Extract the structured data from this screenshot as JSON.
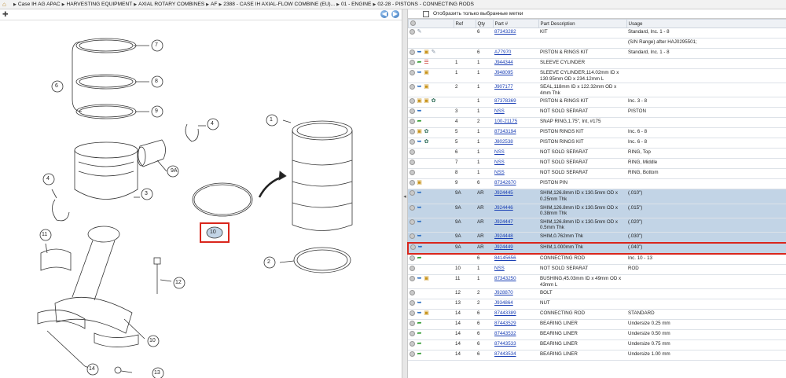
{
  "breadcrumb": [
    "Case IH AG APAC",
    "HARVESTING EQUIPMENT",
    "AXIAL ROTARY COMBINES",
    "AF",
    "2388 - CASE IH AXIAL-FLOW COMBINE (EU)...",
    "01 - ENGINE",
    "02-28 - PISTONS - CONNECTING RODS"
  ],
  "filter_label": "Отобразить только выбранные метки",
  "columns": [
    "",
    "Ref",
    "Qty",
    "Part #",
    "Part Description",
    "Usage"
  ],
  "diagram_callouts": [
    "1",
    "2",
    "3",
    "4",
    "4",
    "5",
    "6",
    "7",
    "8",
    "9",
    "9A",
    "10",
    "11",
    "12",
    "13",
    "14"
  ],
  "rows": [
    {
      "icons": [
        "open",
        "wrench"
      ],
      "ref": "",
      "qty": "6",
      "part": "87343282",
      "desc": "KIT",
      "usage": "Standard, Inc. 1 - 8"
    },
    {
      "icons": [],
      "ref": "",
      "qty": "",
      "part": "",
      "desc": "",
      "usage": "(S/N Range) after HAJ0295501;"
    },
    {
      "icons": [
        "open",
        "blue",
        "box",
        "wrench"
      ],
      "ref": "",
      "qty": "6",
      "part": "A77970",
      "desc": "PISTON & RINGS KIT",
      "usage": "Standard, Inc. 1 - 8"
    },
    {
      "icons": [
        "open",
        "green",
        "red"
      ],
      "ref": "1",
      "qty": "1",
      "part": "J944344",
      "desc": "SLEEVE CYLINDER",
      "usage": ""
    },
    {
      "icons": [
        "open",
        "blue",
        "box"
      ],
      "ref": "1",
      "qty": "1",
      "part": "J948095",
      "desc": "SLEEVE CYLINDER,114.02mm ID x 130.95mm OD x 234.12mm L",
      "usage": ""
    },
    {
      "icons": [
        "open",
        "blue",
        "box"
      ],
      "ref": "2",
      "qty": "1",
      "part": "J907177",
      "desc": "SEAL,118mm ID x 122.32mm OD x 4mm Thk",
      "usage": ""
    },
    {
      "icons": [
        "open",
        "box",
        "box",
        "gear"
      ],
      "ref": "",
      "qty": "1",
      "part": "87378369",
      "desc": "PISTON & RINGS KIT",
      "usage": "Inc. 3 - 8"
    },
    {
      "icons": [
        "open",
        "blue"
      ],
      "ref": "3",
      "qty": "1",
      "part": "NSS",
      "desc": "NOT SOLD SEPARAT",
      "usage": "PISTON"
    },
    {
      "icons": [
        "open",
        "green"
      ],
      "ref": "4",
      "qty": "2",
      "part": "100-21175",
      "desc": "SNAP RING,1.75\", Int, #175",
      "usage": ""
    },
    {
      "icons": [
        "open",
        "box",
        "gear"
      ],
      "ref": "5",
      "qty": "1",
      "part": "87343194",
      "desc": "PISTON RINGS KIT",
      "usage": "Inc. 6 - 8"
    },
    {
      "icons": [
        "open",
        "blue",
        "gear"
      ],
      "ref": "5",
      "qty": "1",
      "part": "J802538",
      "desc": "PISTON RINGS KIT",
      "usage": "Inc. 6 - 8"
    },
    {
      "icons": [
        "open"
      ],
      "ref": "6",
      "qty": "1",
      "part": "NSS",
      "desc": "NOT SOLD SEPARAT",
      "usage": "RING, Top"
    },
    {
      "icons": [
        "open"
      ],
      "ref": "7",
      "qty": "1",
      "part": "NSS",
      "desc": "NOT SOLD SEPARAT",
      "usage": "RING, Middle"
    },
    {
      "icons": [
        "open"
      ],
      "ref": "8",
      "qty": "1",
      "part": "NSS",
      "desc": "NOT SOLD SEPARAT",
      "usage": "RING, Bottom"
    },
    {
      "icons": [
        "open",
        "box"
      ],
      "ref": "9",
      "qty": "6",
      "part": "87342670",
      "desc": "PISTON PIN",
      "usage": ""
    },
    {
      "icons": [
        "open",
        "blue"
      ],
      "ref": "9A",
      "qty": "AR",
      "part": "J924445",
      "desc": "SHIM,126.8mm ID x 130.5mm OD x 0.25mm Thk",
      "usage": "(.010\")",
      "sel": true
    },
    {
      "icons": [
        "open",
        "blue"
      ],
      "ref": "9A",
      "qty": "AR",
      "part": "J924446",
      "desc": "SHIM,126.8mm ID x 130.5mm OD x 0.38mm Thk",
      "usage": "(.015\")",
      "sel": true
    },
    {
      "icons": [
        "open",
        "blue"
      ],
      "ref": "9A",
      "qty": "AR",
      "part": "J924447",
      "desc": "SHIM,126.8mm ID x 130.5mm OD x 0.5mm Thk",
      "usage": "(.020\")",
      "sel": true
    },
    {
      "icons": [
        "open",
        "blue"
      ],
      "ref": "9A",
      "qty": "AR",
      "part": "J924448",
      "desc": "SHIM,0.762mm Thk",
      "usage": "(.030\")",
      "sel": true
    },
    {
      "icons": [
        "open",
        "blue"
      ],
      "ref": "9A",
      "qty": "AR",
      "part": "J924449",
      "desc": "SHIM,1.000mm Thk",
      "usage": "(.040\")",
      "sel": true,
      "hl": true
    },
    {
      "icons": [
        "open",
        "green"
      ],
      "ref": "",
      "qty": "6",
      "part": "84145656",
      "desc": "CONNECTING ROD",
      "usage": "Inc. 10 - 13"
    },
    {
      "icons": [
        "open"
      ],
      "ref": "10",
      "qty": "1",
      "part": "NSS",
      "desc": "NOT SOLD SEPARAT",
      "usage": "ROD"
    },
    {
      "icons": [
        "open",
        "blue",
        "box"
      ],
      "ref": "11",
      "qty": "1",
      "part": "87343250",
      "desc": "BUSHING,45.03mm ID x 49mm OD x 43mm L",
      "usage": ""
    },
    {
      "icons": [
        "open"
      ],
      "ref": "12",
      "qty": "2",
      "part": "J928870",
      "desc": "BOLT",
      "usage": ""
    },
    {
      "icons": [
        "open",
        "blue"
      ],
      "ref": "13",
      "qty": "2",
      "part": "J934864",
      "desc": "NUT",
      "usage": ""
    },
    {
      "icons": [
        "open",
        "blue",
        "box"
      ],
      "ref": "14",
      "qty": "6",
      "part": "87443389",
      "desc": "CONNECTING ROD",
      "usage": "STANDARD"
    },
    {
      "icons": [
        "open",
        "green"
      ],
      "ref": "14",
      "qty": "6",
      "part": "87443529",
      "desc": "BEARING LINER",
      "usage": "Undersize 0.25 mm"
    },
    {
      "icons": [
        "open",
        "green"
      ],
      "ref": "14",
      "qty": "6",
      "part": "87443532",
      "desc": "BEARING LINER",
      "usage": "Undersize 0.50 mm"
    },
    {
      "icons": [
        "open",
        "green"
      ],
      "ref": "14",
      "qty": "6",
      "part": "87443533",
      "desc": "BEARING LINER",
      "usage": "Undersize 0.75 mm"
    },
    {
      "icons": [
        "open",
        "green"
      ],
      "ref": "14",
      "qty": "6",
      "part": "87443534",
      "desc": "BEARING LINER",
      "usage": "Undersize 1.00 mm"
    }
  ],
  "colors": {
    "selected_row": "#c2d4e6",
    "highlight_border": "#d9261c",
    "link": "#1a3fb5"
  }
}
